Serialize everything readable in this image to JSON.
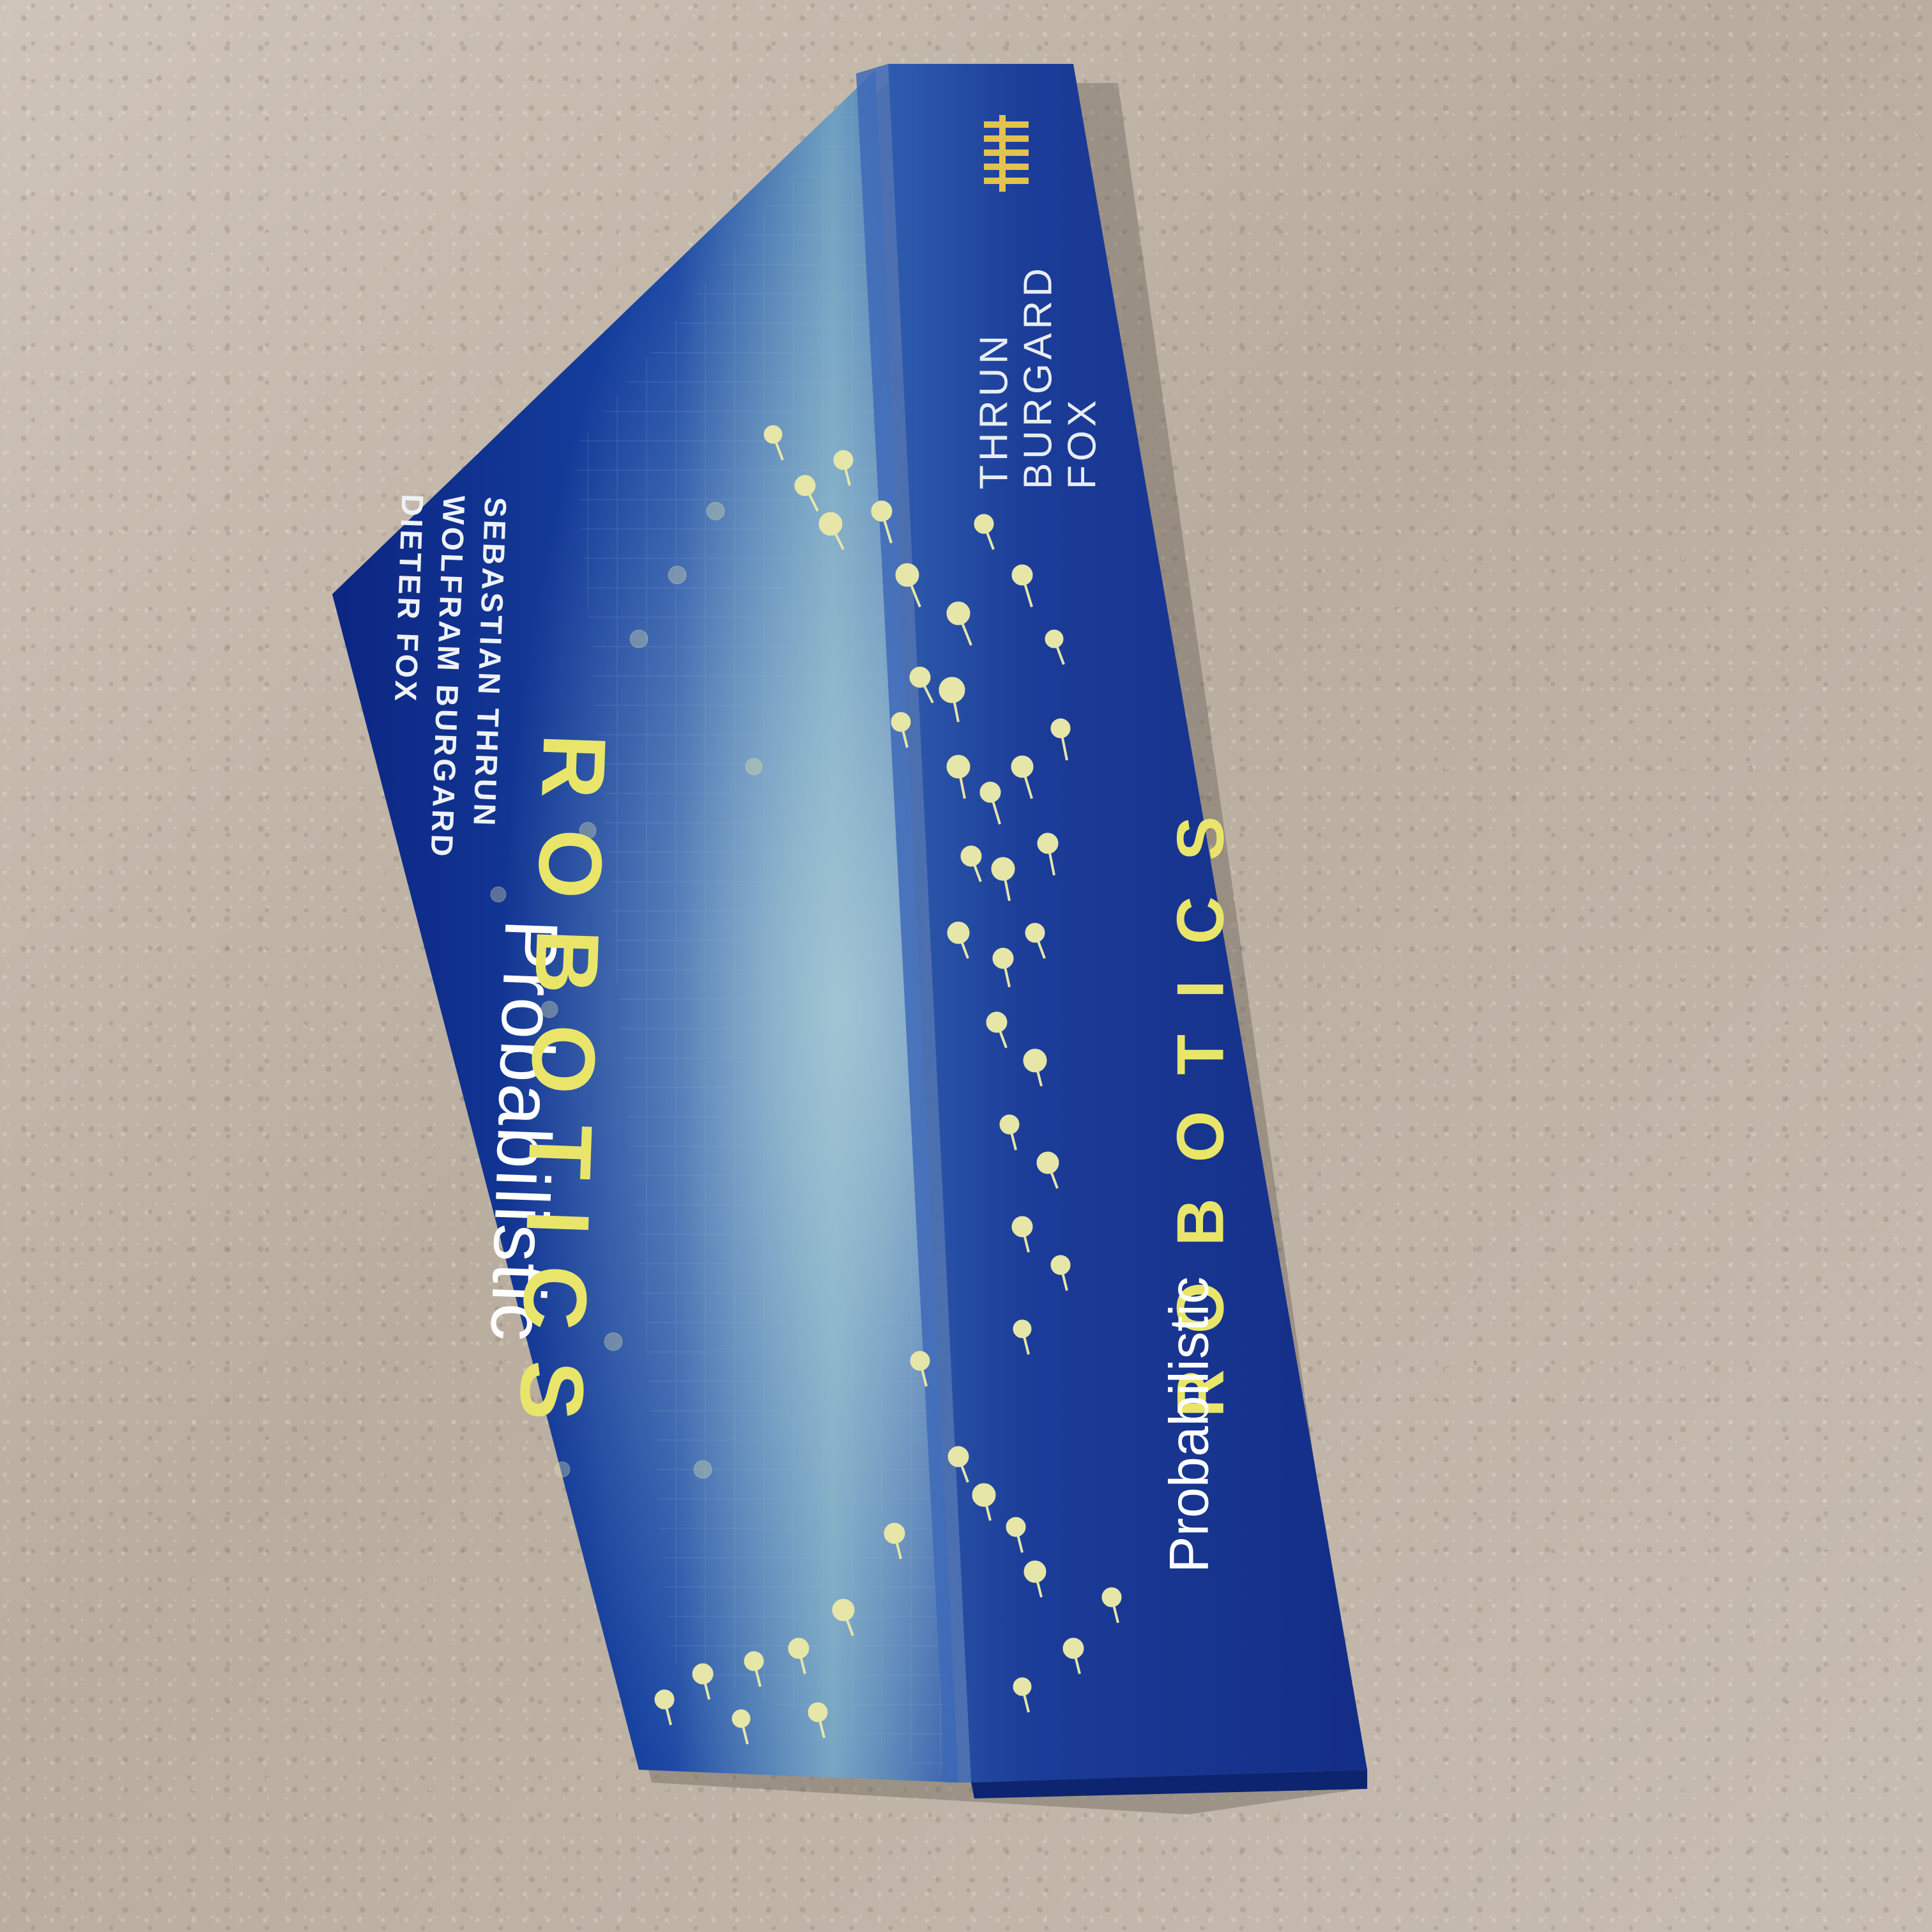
{
  "scene": {
    "colors": {
      "carpet": "#c3b7aa",
      "cover_dark_blue": "#0f2a8a",
      "cover_light_teal": "#8fb8c8",
      "accent_yellow": "#e9e56a",
      "dot_color": "#e6e6a8",
      "spine_blue": "#1a3893"
    }
  },
  "book": {
    "cover": {
      "title_line1": "Probabilistic",
      "title_line2": "ROBOTICS",
      "authors": [
        "SEBASTIAN THRUN",
        "WOLFRAM BURGARD",
        "DIETER FOX"
      ]
    },
    "spine": {
      "authors": [
        "THRUN",
        "BURGARD",
        "FOX"
      ],
      "title_line1": "Probabilistic",
      "title_line2": "ROBOTICS",
      "publisher_logo": "mit-press-logo"
    }
  }
}
